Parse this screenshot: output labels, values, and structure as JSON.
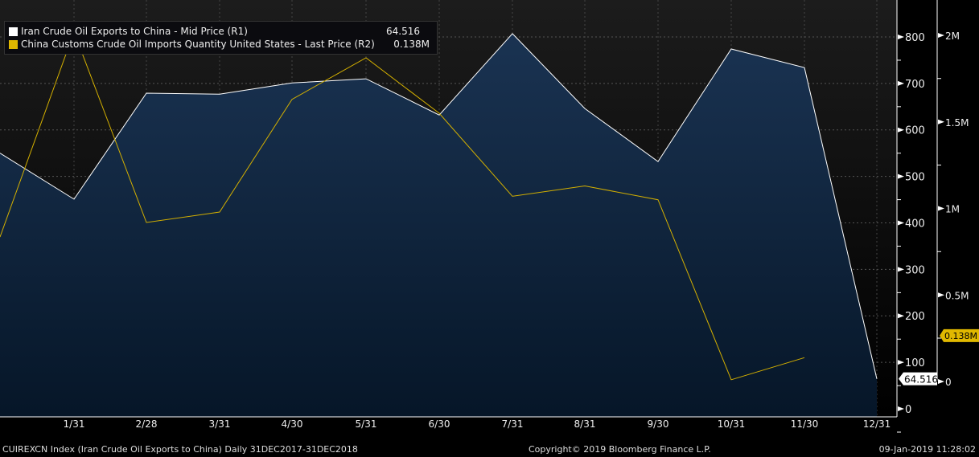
{
  "chart_data": {
    "type": "line",
    "x": [
      "12/31/2017",
      "1/31",
      "2/28",
      "3/31",
      "4/30",
      "5/31",
      "6/30",
      "7/31",
      "8/31",
      "9/30",
      "10/31",
      "11/30",
      "12/31"
    ],
    "x_tick_labels": [
      "1/31",
      "2/28",
      "3/31",
      "4/30",
      "5/31",
      "6/30",
      "7/31",
      "8/31",
      "9/30",
      "10/31",
      "11/30",
      "12/31"
    ],
    "series": [
      {
        "name": "Iran Crude Oil Exports to China - Mid Price (R1)",
        "last": "64.516",
        "axis": "R1",
        "style": "area",
        "color": "#ffffff",
        "values": [
          550,
          451,
          679,
          677,
          701,
          710,
          632,
          807,
          646,
          532,
          774,
          734,
          64.516
        ]
      },
      {
        "name": "China Customs Crude Oil Imports Quantity United States - Last Price (R2)",
        "last": "0.138M",
        "axis": "R2",
        "style": "line",
        "color": "#e0b800",
        "values": [
          835000,
          2020000,
          919000,
          979000,
          1630000,
          1870000,
          1550000,
          1070000,
          1130000,
          1050000,
          10000,
          138000,
          null
        ]
      }
    ],
    "r1_axis": {
      "ylim": [
        0,
        820
      ],
      "ticks": [
        "0",
        "100",
        "200",
        "300",
        "400",
        "500",
        "600",
        "700",
        "800"
      ]
    },
    "r2_axis": {
      "ylim": [
        0,
        2000000
      ],
      "ticks": [
        "0",
        "0.5M",
        "1M",
        "1.5M",
        "2M"
      ]
    },
    "grid": true,
    "legend": "top-left"
  },
  "footer": {
    "left": "CUIREXCN Index (Iran Crude Oil Exports to China)  Daily 31DEC2017-31DEC2018",
    "center": "Copyright© 2019 Bloomberg Finance L.P.",
    "right": "09-Jan-2019 11:28:02"
  }
}
